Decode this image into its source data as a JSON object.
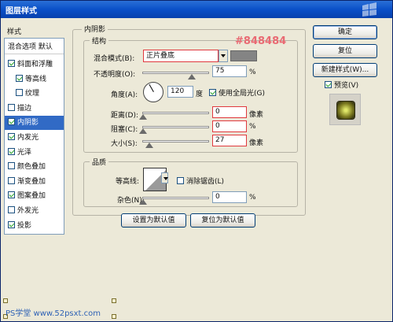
{
  "window": {
    "title": "图层样式"
  },
  "left": {
    "header": "样式",
    "blend_default": "混合选项 默认",
    "items": [
      {
        "label": "斜面和浮雕",
        "checked": true,
        "selected": false,
        "indent": false
      },
      {
        "label": "等高线",
        "checked": true,
        "selected": false,
        "indent": true
      },
      {
        "label": "纹理",
        "checked": false,
        "selected": false,
        "indent": true
      },
      {
        "label": "描边",
        "checked": false,
        "selected": false,
        "indent": false
      },
      {
        "label": "内阴影",
        "checked": true,
        "selected": true,
        "indent": false
      },
      {
        "label": "内发光",
        "checked": true,
        "selected": false,
        "indent": false
      },
      {
        "label": "光泽",
        "checked": true,
        "selected": false,
        "indent": false
      },
      {
        "label": "颜色叠加",
        "checked": false,
        "selected": false,
        "indent": false
      },
      {
        "label": "渐变叠加",
        "checked": false,
        "selected": false,
        "indent": false
      },
      {
        "label": "图案叠加",
        "checked": true,
        "selected": false,
        "indent": false
      },
      {
        "label": "外发光",
        "checked": false,
        "selected": false,
        "indent": false
      },
      {
        "label": "投影",
        "checked": true,
        "selected": false,
        "indent": false
      }
    ]
  },
  "inner_shadow": {
    "section_title": "内阴影",
    "structure_title": "结构",
    "blend_mode_label": "混合模式(B):",
    "blend_mode_value": "正片叠底",
    "color_hex": "#848484",
    "swatch_color": "#848484",
    "opacity_label": "不透明度(O):",
    "opacity_value": "75",
    "opacity_pct": 75,
    "angle_label": "角度(A):",
    "angle_value": "120",
    "angle_unit": "度",
    "global_light_label": "使用全局光(G)",
    "distance_label": "距离(D):",
    "distance_value": "0",
    "distance_unit": "像素",
    "distance_pct": 0,
    "choke_label": "阻塞(C):",
    "choke_value": "0",
    "choke_pct": 0,
    "size_label": "大小(S):",
    "size_value": "27",
    "size_unit": "像素",
    "size_pct": 10,
    "percent": "%"
  },
  "quality": {
    "title": "品质",
    "contour_label": "等高线:",
    "antialias_label": "消除锯齿(L)",
    "noise_label": "杂色(N):",
    "noise_value": "0",
    "noise_pct": 0,
    "percent": "%"
  },
  "footer_buttons": {
    "set_default": "设置为默认值",
    "reset_default": "复位为默认值"
  },
  "right": {
    "ok": "确定",
    "cancel": "复位",
    "new_style": "新建样式(W)...",
    "preview_label": "预览(V)"
  },
  "watermark": "PS学堂 www.52psxt.com"
}
